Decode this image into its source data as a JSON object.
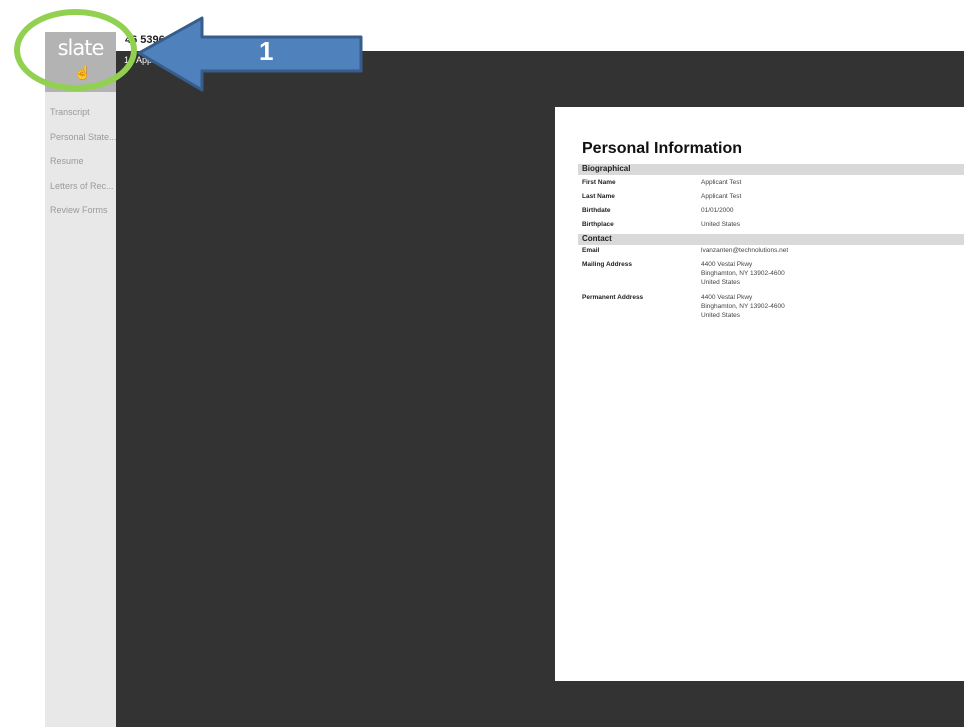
{
  "app": {
    "logo_text": "slate"
  },
  "header": {
    "record_id": "46 5396",
    "page_indicator": "1 / Applic"
  },
  "sidebar": {
    "items": [
      {
        "label": "Transcript"
      },
      {
        "label": "Personal State..."
      },
      {
        "label": "Resume"
      },
      {
        "label": "Letters of Rec..."
      },
      {
        "label": "Review Forms"
      }
    ]
  },
  "document": {
    "title": "Personal Information",
    "sections": [
      {
        "title": "Biographical",
        "rows": [
          {
            "label": "First Name",
            "value": "Applicant Test"
          },
          {
            "label": "Last Name",
            "value": "Applicant Test"
          },
          {
            "label": "Birthdate",
            "value": "01/01/2000"
          },
          {
            "label": "Birthplace",
            "value": "United States"
          }
        ]
      },
      {
        "title": "Contact",
        "rows": [
          {
            "label": "Email",
            "value": "lvanzanten@technolutions.net"
          },
          {
            "label": "Mailing Address",
            "value_lines": [
              "4400 Vestal Pkwy",
              "Binghamton, NY 13902-4600",
              "United States"
            ]
          },
          {
            "label": "Permanent Address",
            "value_lines": [
              "4400 Vestal Pkwy",
              "Binghamton, NY 13902-4600",
              "United States"
            ]
          }
        ]
      }
    ]
  },
  "annotation": {
    "step_number": "1",
    "circle_color": "#92d050",
    "arrow_color": "#4f81bd"
  },
  "colors": {
    "viewer_bg": "#333333",
    "sidebar_bg": "#e8e8e8",
    "logo_bg": "#b3b3b3"
  }
}
